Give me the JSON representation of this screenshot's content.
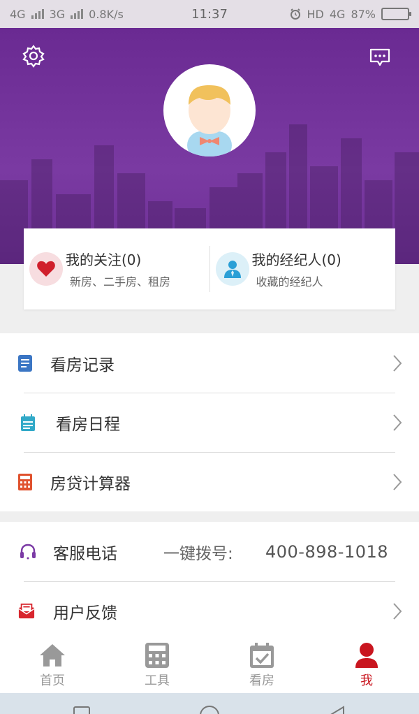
{
  "status_bar": {
    "network1": "4G",
    "network2": "3G",
    "speed": "0.8K/s",
    "time": "11:37",
    "hd": "HD",
    "network3": "4G",
    "battery": "87%",
    "battery_level": 0.87
  },
  "header": {
    "settings_icon": "gear-icon",
    "message_icon": "message-icon",
    "avatar_icon": "user-avatar"
  },
  "card": {
    "follow": {
      "title": "我的关注(0)",
      "subtitle": "新房、二手房、租房",
      "icon": "heart-icon",
      "accent": "#d01f2c"
    },
    "agent": {
      "title": "我的经纪人(0)",
      "subtitle": "收藏的经纪人",
      "icon": "agent-icon",
      "accent": "#2a9fd6"
    }
  },
  "menu_group_1": [
    {
      "label": "看房记录",
      "icon": "document-icon",
      "color": "#3b76c4"
    },
    {
      "label": "看房日程",
      "icon": "calendar-icon",
      "color": "#31a9c8"
    },
    {
      "label": "房贷计算器",
      "icon": "calculator-icon",
      "color": "#e0522e"
    }
  ],
  "menu_group_2": {
    "service": {
      "label": "客服电话",
      "prefix": "一键拨号:",
      "number": "400-898-1018",
      "icon": "headset-icon",
      "color": "#7b3aa5"
    },
    "feedback": {
      "label": "用户反馈",
      "icon": "feedback-icon",
      "color": "#d8262e"
    }
  },
  "tabs": [
    {
      "label": "首页",
      "icon": "home-icon"
    },
    {
      "label": "工具",
      "icon": "calculator-icon"
    },
    {
      "label": "看房",
      "icon": "calendar-check-icon"
    },
    {
      "label": "我",
      "icon": "person-icon",
      "active": true
    }
  ],
  "colors": {
    "brand_purple": "#6d2f95",
    "active_red": "#c9161f",
    "inactive_gray": "#999999"
  }
}
